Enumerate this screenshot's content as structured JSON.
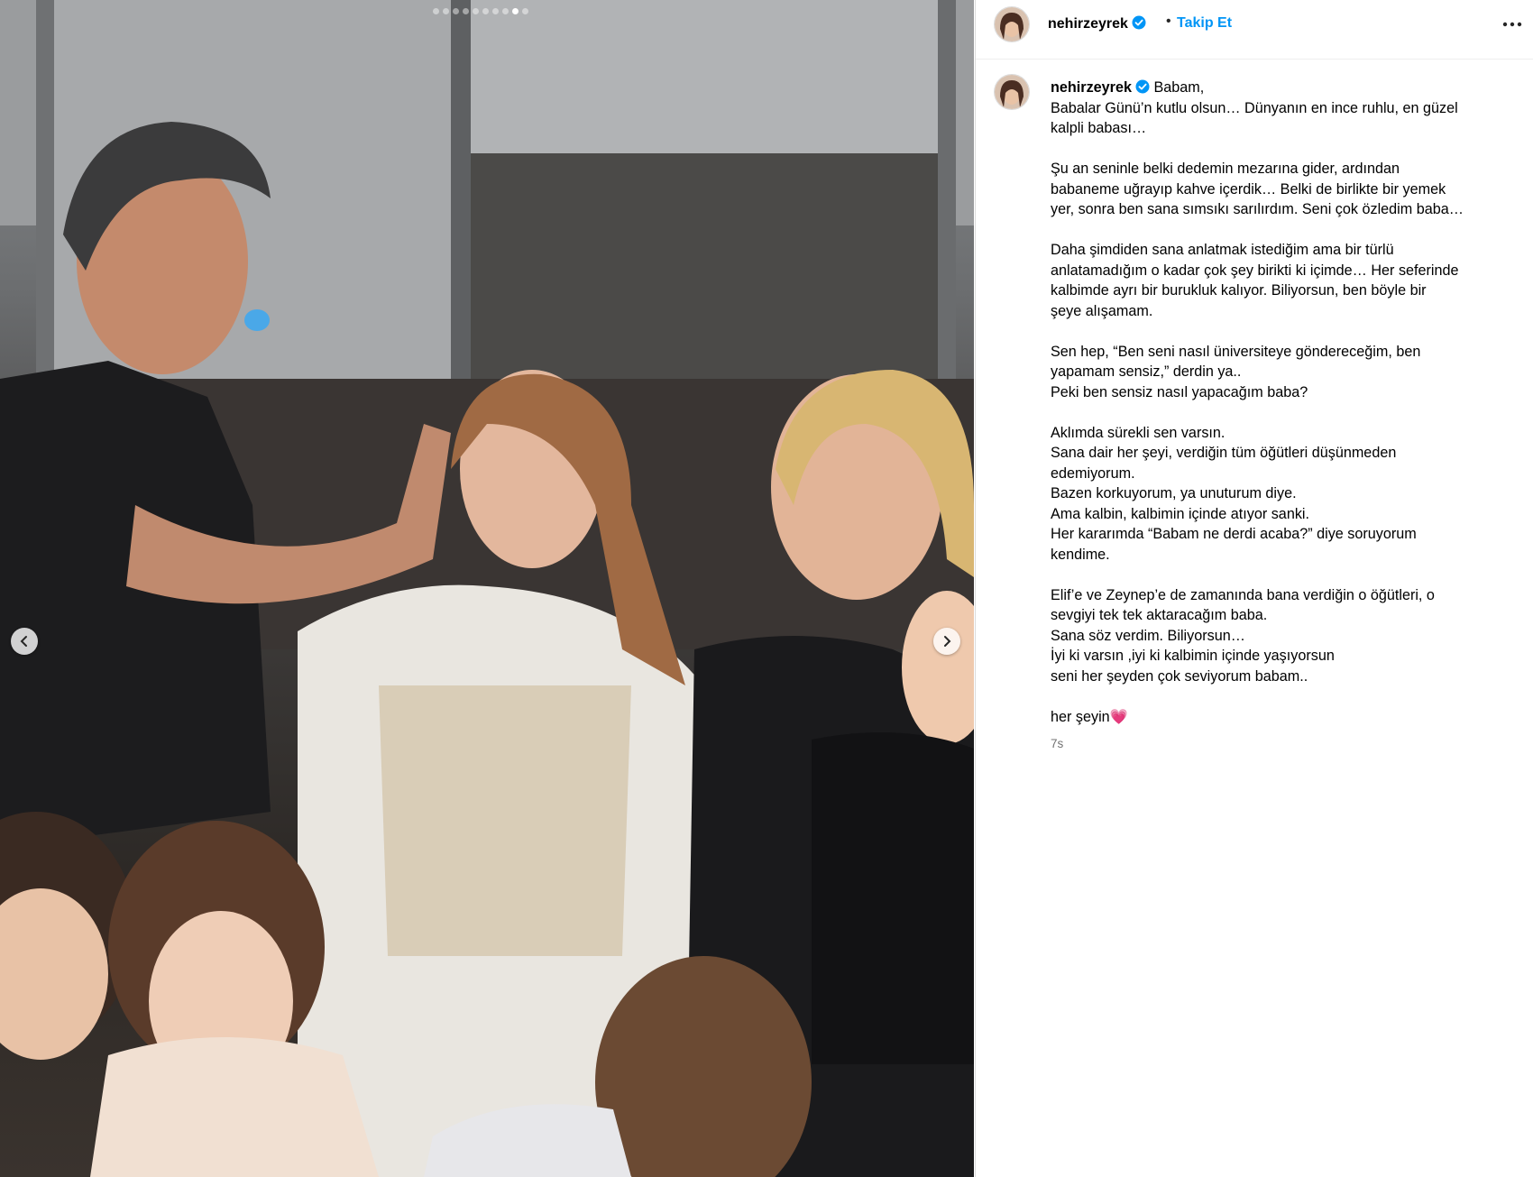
{
  "post": {
    "carousel": {
      "total_slides": 10,
      "active_index": 8
    },
    "username": "nehirzeyrek",
    "follow_label": "Takip Et",
    "separator": "•",
    "caption_first": "Babam,",
    "caption_lines": [
      "Babalar Günü’n kutlu olsun… Dünyanın en ince ruhlu, en güzel",
      "kalpli babası…",
      "",
      "Şu an seninle belki dedemin mezarına gider, ardından",
      "babaneme uğrayıp kahve içerdik… Belki de birlikte bir yemek",
      "yer, sonra ben sana sımsıkı sarılırdım. Seni çok özledim baba…",
      "",
      "Daha şimdiden sana anlatmak istediğim ama bir türlü",
      "anlatamadığım o kadar çok şey birikti ki içimde… Her seferinde",
      "kalbimde ayrı bir burukluk kalıyor. Biliyorsun, ben böyle bir",
      "şeye alışamam.",
      "",
      "Sen hep, “Ben seni nasıl üniversiteye göndereceğim, ben",
      "yapamam sensiz,” derdin ya..",
      "Peki ben sensiz nasıl yapacağım baba?",
      "",
      "Aklımda sürekli sen varsın.",
      "Sana dair her şeyi, verdiğin tüm öğütleri düşünmeden",
      "edemiyorum.",
      "Bazen korkuyorum, ya unuturum diye.",
      "Ama kalbin, kalbimin içinde atıyor sanki.",
      "Her kararımda “Babam ne derdi acaba?” diye soruyorum",
      "kendime.",
      "",
      "Elif’e ve Zeynep’e de zamanında bana verdiğin o öğütleri, o",
      "sevgiyi tek tek aktaracağım baba.",
      "Sana söz verdim. Biliyorsun…",
      "İyi ki varsın ,iyi ki kalbimin içinde yaşıyorsun",
      "seni her şeyden çok seviyorum babam..",
      ""
    ],
    "signoff": "her şeyin",
    "signoff_emoji": "💗",
    "timestamp": "7s",
    "colors": {
      "follow": "#0095f6",
      "verified": "#0095f6",
      "timestamp": "#737373"
    },
    "icons": [
      "verified-badge-icon",
      "more-options-icon",
      "chevron-left-icon",
      "chevron-right-icon"
    ]
  }
}
